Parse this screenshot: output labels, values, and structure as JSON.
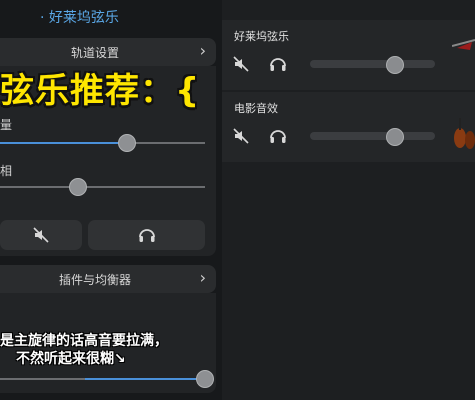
{
  "header": {
    "title": "· 好莱坞弦乐"
  },
  "track_settings": {
    "title": "轨道设置",
    "volume_label": "量",
    "volume_value": 0.62,
    "pan_label": "相",
    "pan_value": 0.38
  },
  "plugins": {
    "title": "插件与均衡器",
    "slider_value": 1.0
  },
  "overlay": {
    "title": "弦乐推荐：{",
    "caption_line1": "是主旋律的话高音要拉满，",
    "caption_line2": "不然听起来很糊↘"
  },
  "tracks": [
    {
      "name": "好莱坞弦乐",
      "volume": 0.68
    },
    {
      "name": "电影音效",
      "volume": 0.68
    }
  ]
}
